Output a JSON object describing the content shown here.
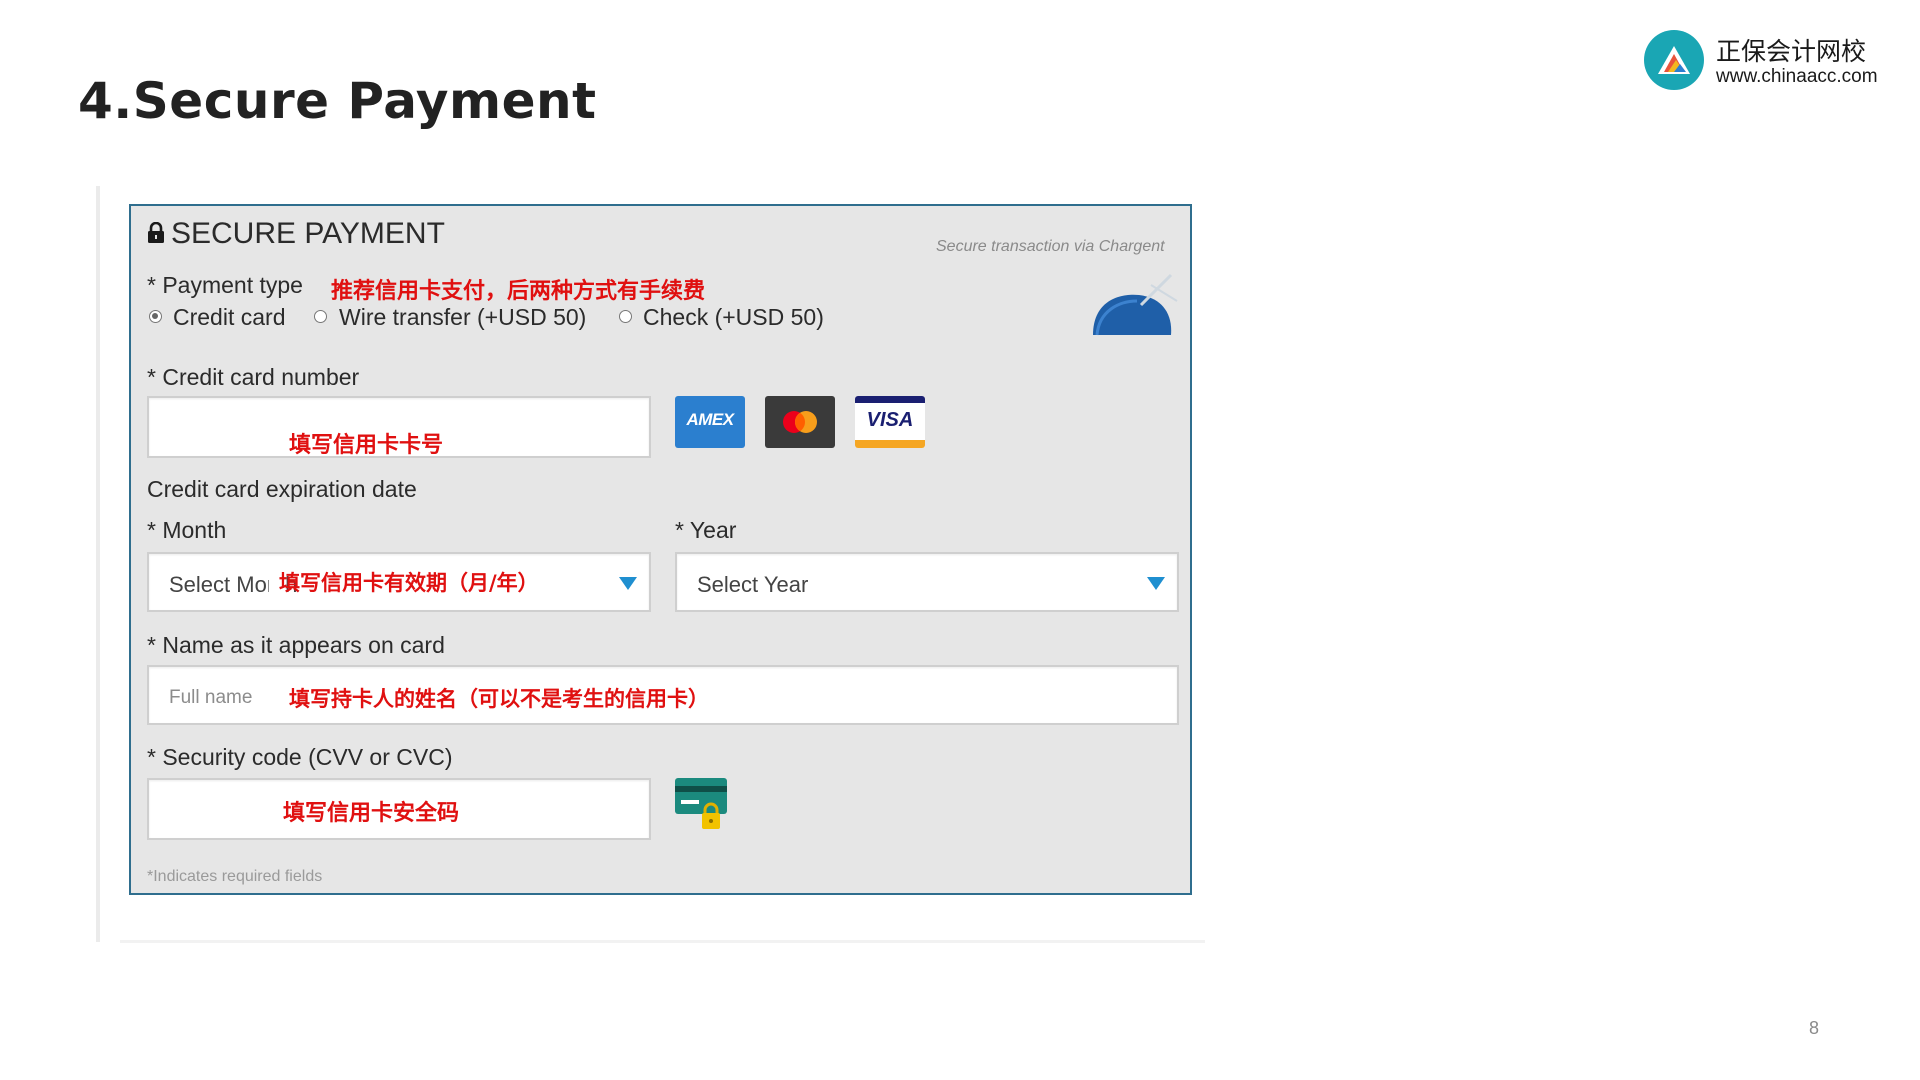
{
  "slide": {
    "title": "4.Secure Payment",
    "page_number": "8"
  },
  "logo": {
    "name": "正保会计网校",
    "url": "www.chinaacc.com"
  },
  "form": {
    "title": "SECURE PAYMENT",
    "secure_note": "Secure transaction via Chargent",
    "payment_type_label": "* Payment type",
    "payment_type_note": "推荐信用卡支付，后两种方式有手续费",
    "payment_options": [
      {
        "label": "Credit card",
        "selected": true
      },
      {
        "label": "Wire transfer (+USD 50)",
        "selected": false
      },
      {
        "label": "Check (+USD 50)",
        "selected": false
      }
    ],
    "card_number_label": "* Credit card number",
    "card_number_note": "填写信用卡卡号",
    "card_brands": [
      "AMEX",
      "mastercard",
      "VISA"
    ],
    "expiration_label": "Credit card expiration date",
    "month_label": "* Month",
    "month_value": "Select Month",
    "month_note": "填写信用卡有效期（月/年）",
    "year_label": "* Year",
    "year_value": "Select Year",
    "name_label": "* Name as it appears on card",
    "name_placeholder": "Full name",
    "name_note": "填写持卡人的姓名（可以不是考生的信用卡）",
    "security_label": "* Security code (CVV or CVC)",
    "security_note": "填写信用卡安全码",
    "required_note": "*Indicates required fields"
  },
  "colors": {
    "panel_bg": "#e6e6e6",
    "panel_border": "#2f6e8e",
    "annotation_red": "#e01010",
    "dropdown_arrow": "#1f8fd0"
  },
  "icons": [
    "lock-icon",
    "chargent-logo-icon",
    "amex-card-icon",
    "mastercard-icon",
    "visa-card-icon",
    "security-code-card-icon",
    "chinaacc-logo-icon"
  ]
}
